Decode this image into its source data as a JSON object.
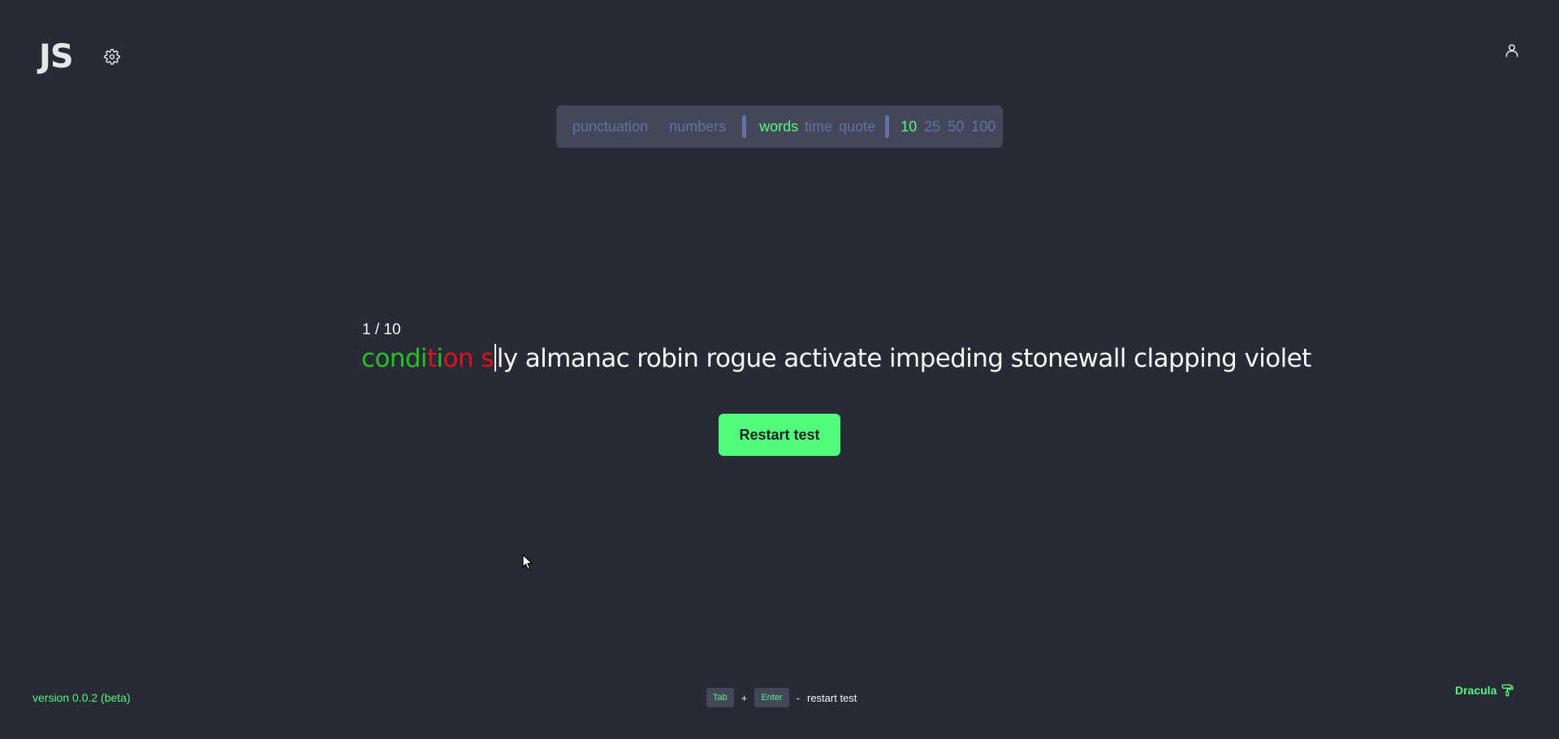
{
  "header": {
    "logo": "JS",
    "settings_icon": "gear-icon",
    "account_icon": "user-icon"
  },
  "config": {
    "toggles": [
      {
        "label": "punctuation",
        "active": false
      },
      {
        "label": "numbers",
        "active": false
      }
    ],
    "modes": [
      {
        "label": "words",
        "active": true
      },
      {
        "label": "time",
        "active": false
      },
      {
        "label": "quote",
        "active": false
      }
    ],
    "counts": [
      {
        "label": "10",
        "active": true
      },
      {
        "label": "25",
        "active": false
      },
      {
        "label": "50",
        "active": false
      },
      {
        "label": "100",
        "active": false
      }
    ]
  },
  "test": {
    "progress": "1 / 10",
    "typed_correct_1": "condi",
    "typed_incorrect_1": "t",
    "typed_correct_2": "i",
    "typed_incorrect_2": "on s",
    "remaining": "ly almanac robin rogue activate impeding stonewall clapping violet"
  },
  "restart_button": {
    "label": "Restart test"
  },
  "footer": {
    "version": "version 0.0.2 (beta)",
    "hint_key1": "Tab",
    "hint_plus": "+",
    "hint_key2": "Enter",
    "hint_dash": "-",
    "hint_text": "restart test",
    "theme_name": "Dracula",
    "theme_icon": "paint-roller-icon"
  },
  "colors": {
    "background": "#282a36",
    "panel": "#44475a",
    "accent": "#50fa7b",
    "muted": "#6272a4",
    "correct": "#22c322",
    "incorrect": "#e0111b",
    "text": "#f8f8f2"
  }
}
